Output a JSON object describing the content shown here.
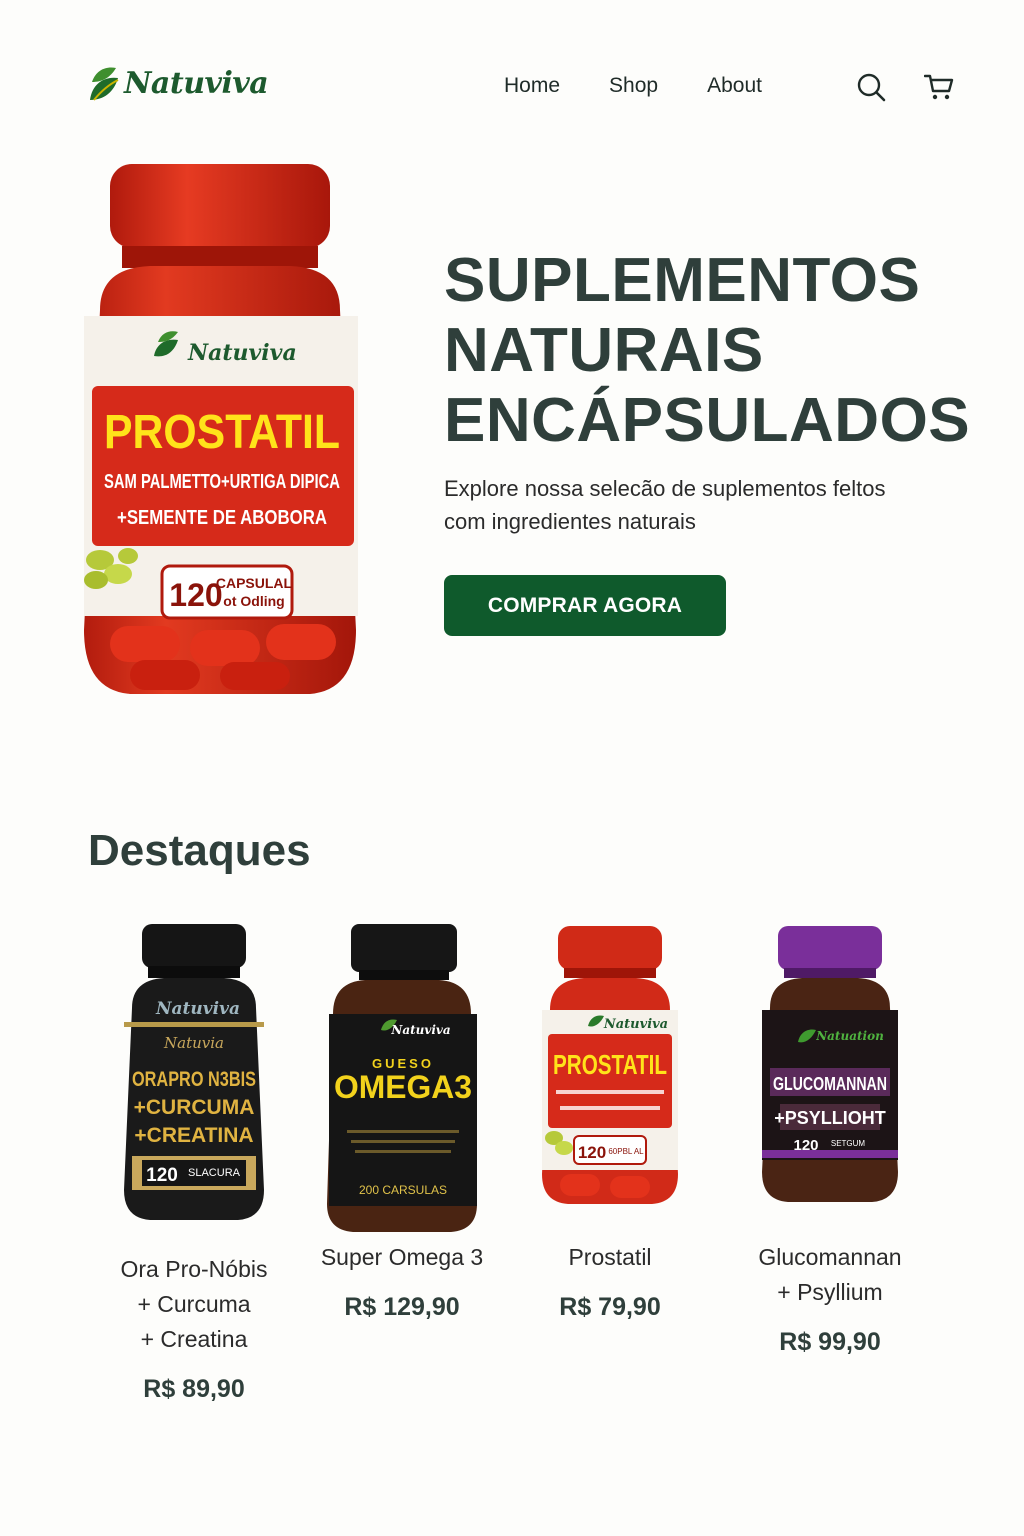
{
  "brand": {
    "name": "Natuviva"
  },
  "nav": {
    "items": [
      "Home",
      "Shop",
      "About"
    ]
  },
  "icons": {
    "search": "search-icon",
    "cart": "cart-icon"
  },
  "hero": {
    "title_lines": [
      "SUPLEMENTOS",
      "NATURAIS",
      "ENCÁPSULADOS"
    ],
    "subtitle": "Explore nossa selecão de suplementos feltos com ingredientes naturais",
    "cta": "COMPRAR AGORA",
    "bottle": {
      "brand": "Natuviva",
      "name": "PROSTATIL",
      "line1": "SAM PALMETTO+URTIGA DIPICA",
      "line2": "+SEMENTE DE ABOBORA",
      "count": "120",
      "count_label1": "CAPSULAL",
      "count_label2": "ot Odling"
    }
  },
  "featured": {
    "title": "Destaques",
    "products": [
      {
        "name_lines": [
          "Ora Pro-Nóbis",
          "+ Curcuma",
          "+ Creatina"
        ],
        "price": "R$ 89,90",
        "label": {
          "brand": "Natuviva",
          "sub": "Natuvia",
          "l1": "ORAPRO N3BIS",
          "l2": "+CURCUMA",
          "l3": "+CREATINA",
          "count": "120",
          "count_text": "SLACURA"
        }
      },
      {
        "name_lines": [
          "Super Omega 3"
        ],
        "price": "R$ 129,90",
        "label": {
          "brand": "Natuviva",
          "sub": "GUESO",
          "l1": "OMEGA3",
          "count_text": "200 CARSULAS"
        }
      },
      {
        "name_lines": [
          "Prostatil"
        ],
        "price": "R$ 79,90",
        "label": {
          "brand": "Natuviva",
          "l1": "PROSTATIL",
          "count": "120",
          "count_text": "60PBL AL"
        }
      },
      {
        "name_lines": [
          "Glucomannan",
          "+ Psyllium"
        ],
        "price": "R$ 99,90",
        "label": {
          "brand": "Natuation",
          "l1": "GLUCOMANNAN",
          "l2": "+PSYLLIOHT",
          "count": "120",
          "count_text": "SETGUM"
        }
      }
    ]
  },
  "colors": {
    "brand_green": "#0f5a2c",
    "text_dark": "#2f3f3b",
    "bottle_red": "#d42a18"
  }
}
